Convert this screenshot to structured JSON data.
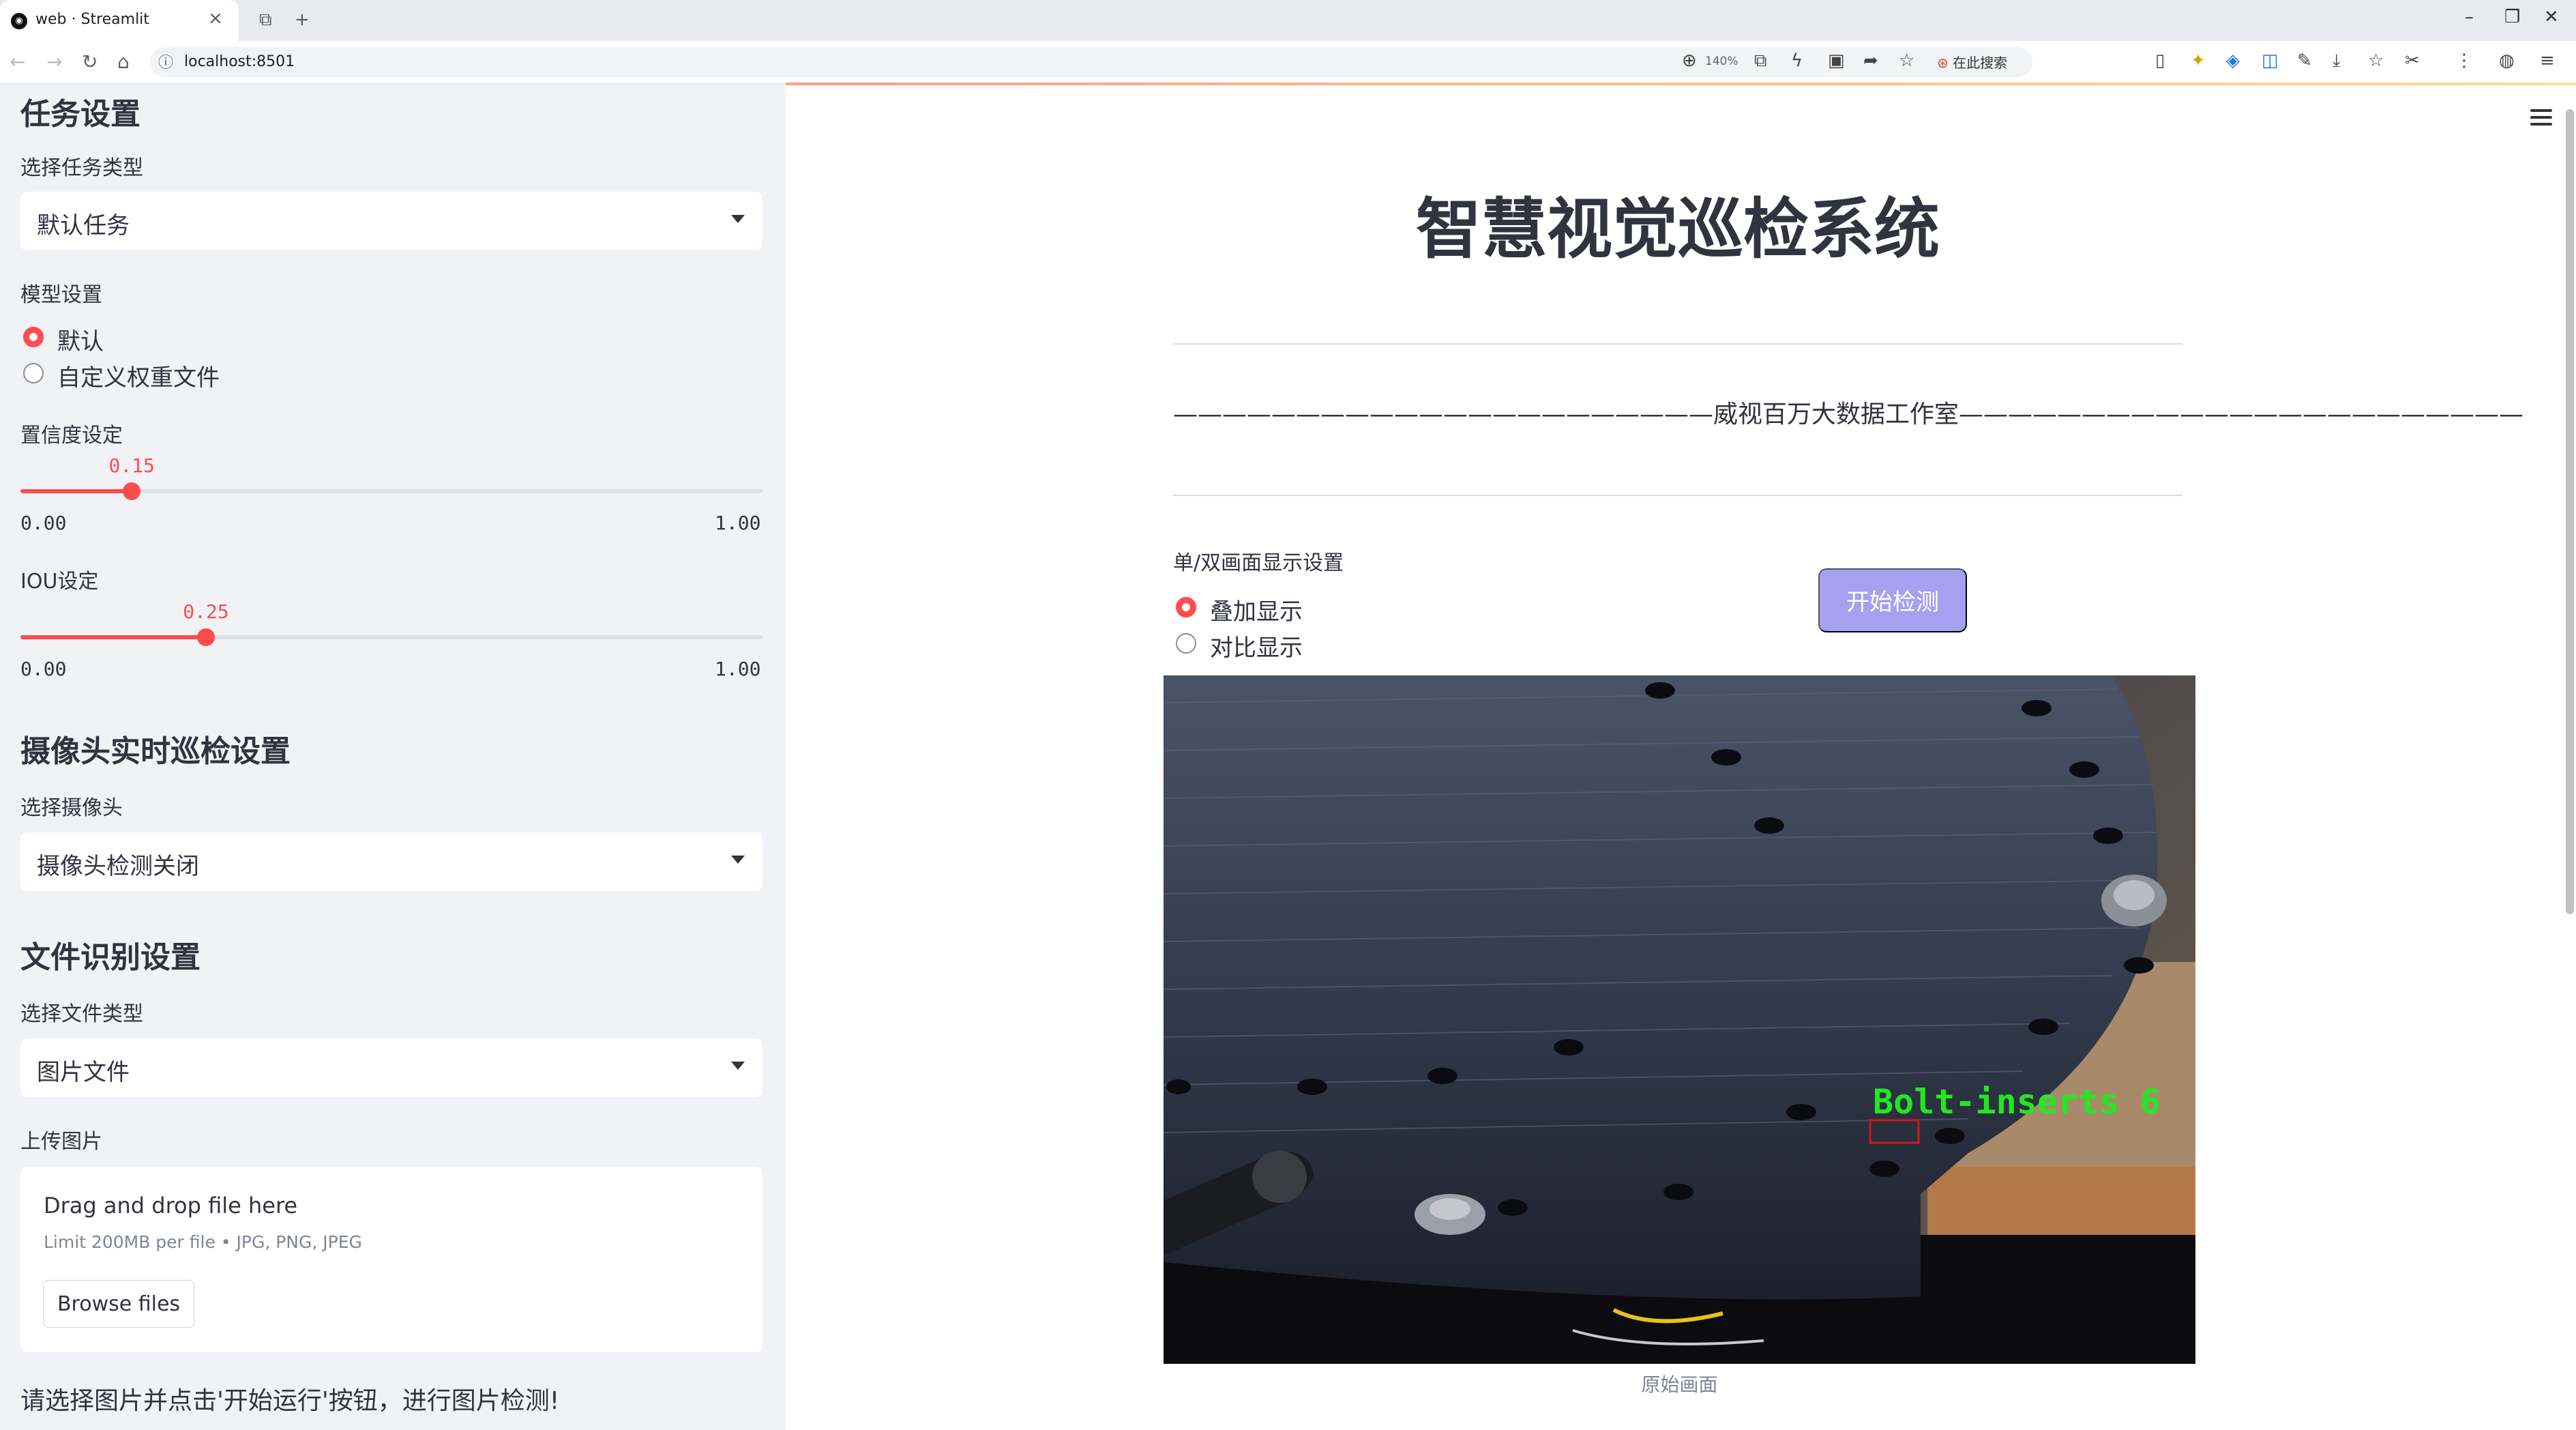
{
  "browser": {
    "tab_title": "web · Streamlit",
    "url": "localhost:8501",
    "zoom": "140%",
    "search_label": "在此搜索"
  },
  "sidebar": {
    "task_section": {
      "heading": "任务设置",
      "select_label": "选择任务类型",
      "select_value": "默认任务"
    },
    "model": {
      "label": "模型设置",
      "options": [
        "默认",
        "自定义权重文件"
      ],
      "selected": 0
    },
    "confidence": {
      "label": "置信度设定",
      "value": "0.15",
      "value_num": 0.15,
      "min": "0.00",
      "max": "1.00"
    },
    "iou": {
      "label": "IOU设定",
      "value": "0.25",
      "value_num": 0.25,
      "min": "0.00",
      "max": "1.00"
    },
    "camera_section": {
      "heading": "摄像头实时巡检设置",
      "select_label": "选择摄像头",
      "select_value": "摄像头检测关闭"
    },
    "file_section": {
      "heading": "文件识别设置",
      "select_label": "选择文件类型",
      "select_value": "图片文件",
      "upload_label": "上传图片",
      "drag_text": "Drag and drop file here",
      "limit_text": "Limit 200MB per file • JPG, PNG, JPEG",
      "browse_label": "Browse files"
    },
    "hint": "请选择图片并点击'开始运行'按钮，进行图片检测!"
  },
  "main": {
    "title": "智慧视觉巡检系统",
    "subtitle_line": "——————————————————————威视百万大数据工作室———————————————————————",
    "display_label": "单/双画面显示设置",
    "display_options": [
      "叠加显示",
      "对比显示"
    ],
    "display_selected": 0,
    "start_button": "开始检测",
    "detection_label": "Bolt-inserts 6",
    "image_caption": "原始画面"
  },
  "colors": {
    "accent": "#ff4b4b",
    "sidebar_bg": "#f0f2f6",
    "button_bg": "#a79ff0",
    "detection_text": "#22e822",
    "detection_box": "#d01818"
  }
}
